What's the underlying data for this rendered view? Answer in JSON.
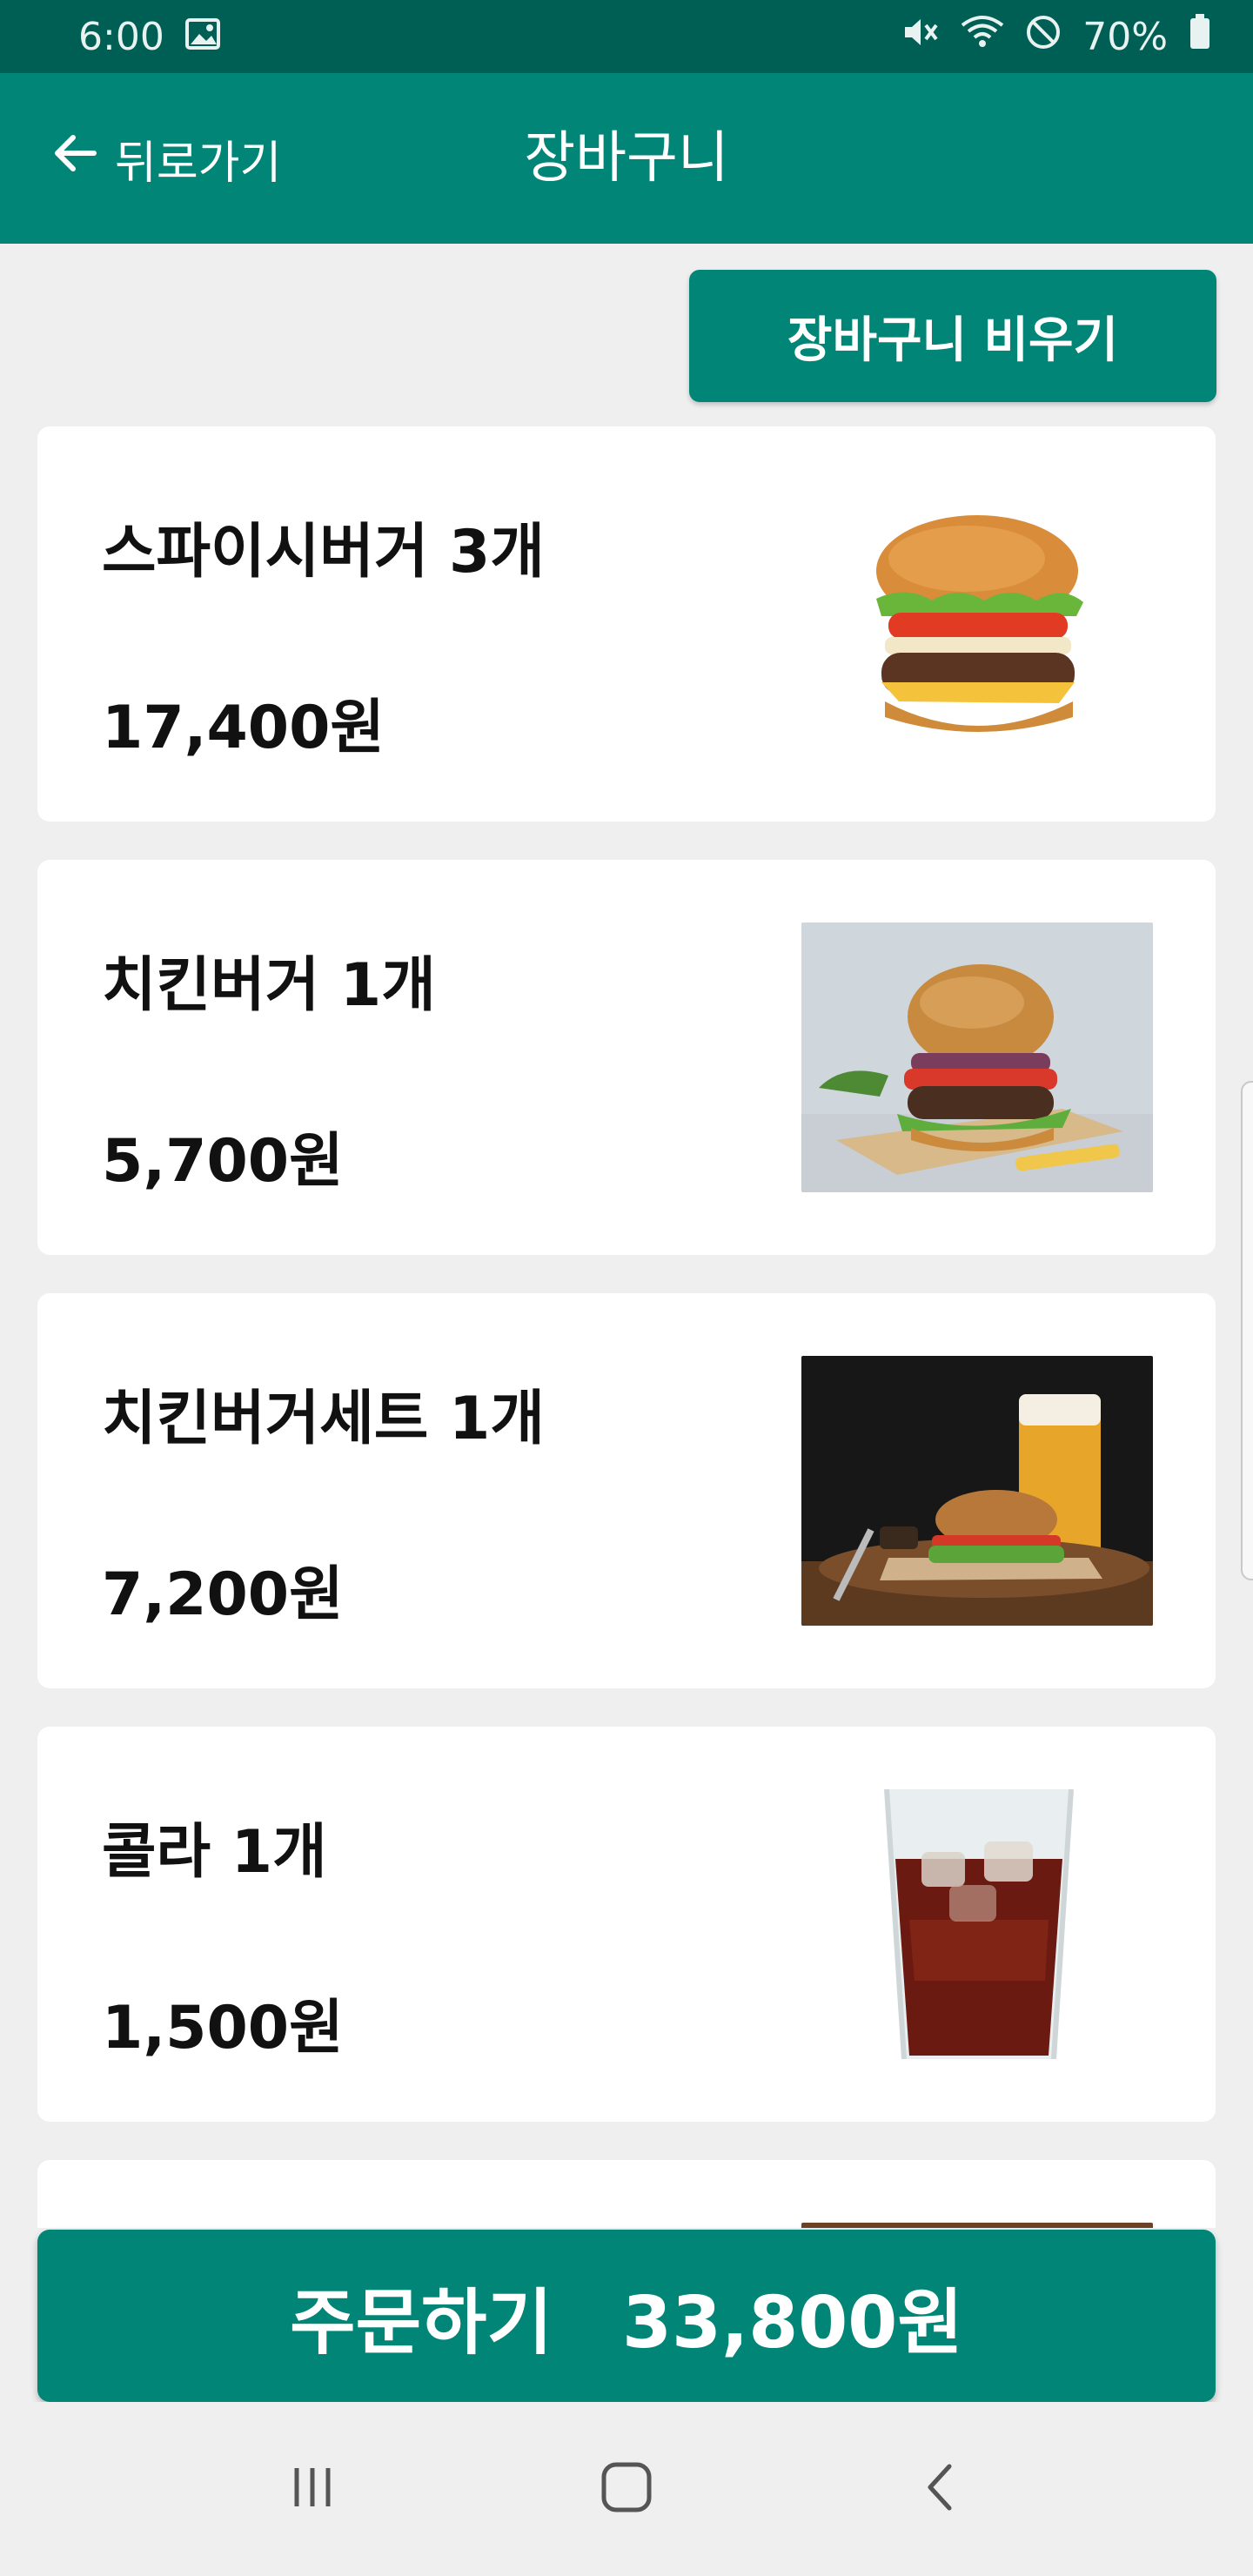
{
  "status": {
    "time": "6:00",
    "battery": "70%"
  },
  "header": {
    "back_label": "뒤로가기",
    "title": "장바구니"
  },
  "clear_cart_label": "장바구니 비우기",
  "items": [
    {
      "name": "스파이시버거 3개",
      "price": "17,400원",
      "image_icon": "spicy-burger-image"
    },
    {
      "name": "치킨버거 1개",
      "price": "5,700원",
      "image_icon": "chicken-burger-image"
    },
    {
      "name": "치킨버거세트 1개",
      "price": "7,200원",
      "image_icon": "chicken-burger-set-image"
    },
    {
      "name": "콜라 1개",
      "price": "1,500원",
      "image_icon": "cola-image"
    }
  ],
  "order": {
    "label": "주문하기",
    "total": "33,800원"
  },
  "colors": {
    "primary": "#008577",
    "status_bar": "#005f55",
    "background": "#efefef"
  }
}
